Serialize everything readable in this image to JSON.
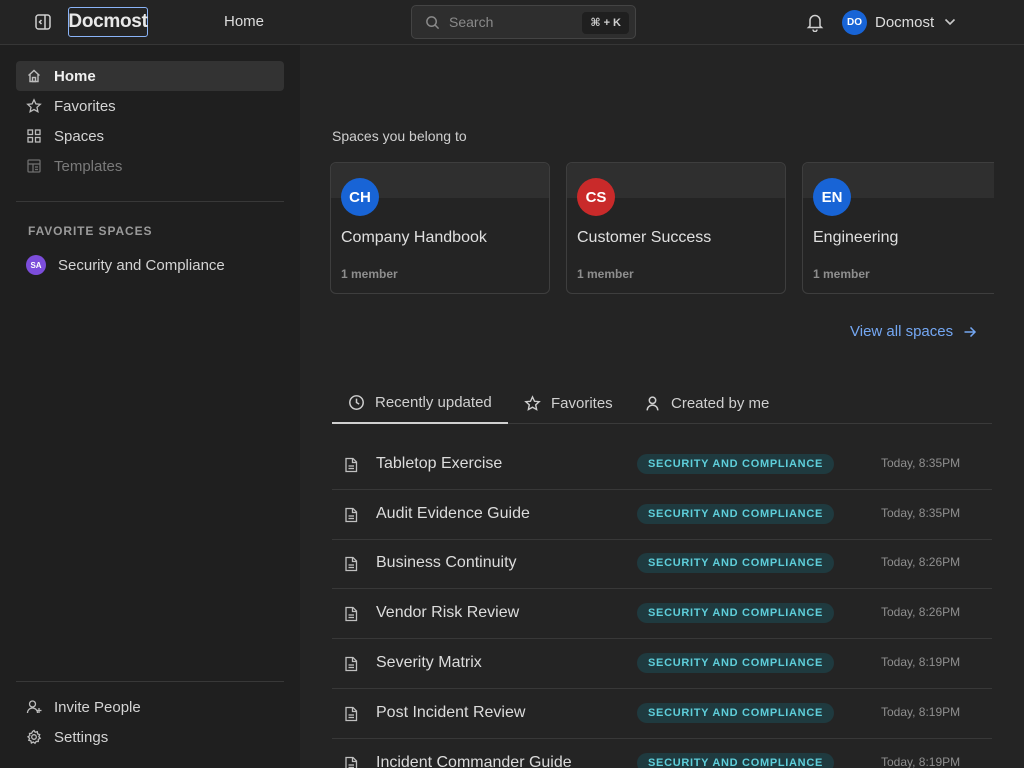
{
  "header": {
    "logo": "Docmost",
    "home": "Home",
    "search_placeholder": "Search",
    "search_shortcut": "⌘ + K",
    "user_initials": "DO",
    "user_name": "Docmost"
  },
  "sidebar": {
    "items": [
      {
        "label": "Home",
        "icon": "home-icon",
        "active": true
      },
      {
        "label": "Favorites",
        "icon": "star-icon"
      },
      {
        "label": "Spaces",
        "icon": "grid-icon"
      },
      {
        "label": "Templates",
        "icon": "template-icon",
        "disabled": true
      }
    ],
    "favorites_heading": "FAVORITE SPACES",
    "favorite_spaces": [
      {
        "initials": "SA",
        "label": "Security and Compliance",
        "color": "#7c4ddb"
      }
    ],
    "footer": [
      {
        "label": "Invite People",
        "icon": "user-plus-icon"
      },
      {
        "label": "Settings",
        "icon": "settings-icon"
      }
    ]
  },
  "main": {
    "spaces_title": "Spaces you belong to",
    "spaces": [
      {
        "initials": "CH",
        "name": "Company Handbook",
        "members": "1 member",
        "color": "#1864d6"
      },
      {
        "initials": "CS",
        "name": "Customer Success",
        "members": "1 member",
        "color": "#c92a2a"
      },
      {
        "initials": "EN",
        "name": "Engineering",
        "members": "1 member",
        "color": "#1864d6"
      }
    ],
    "view_all": "View all spaces",
    "tabs": [
      {
        "label": "Recently updated",
        "icon": "clock-icon",
        "active": true
      },
      {
        "label": "Favorites",
        "icon": "star-icon"
      },
      {
        "label": "Created by me",
        "icon": "user-icon"
      }
    ],
    "pages": [
      {
        "title": "Tabletop Exercise",
        "space": "SECURITY AND COMPLIANCE",
        "time": "Today, 8:35PM"
      },
      {
        "title": "Audit Evidence Guide",
        "space": "SECURITY AND COMPLIANCE",
        "time": "Today, 8:35PM"
      },
      {
        "title": "Business Continuity",
        "space": "SECURITY AND COMPLIANCE",
        "time": "Today, 8:26PM"
      },
      {
        "title": "Vendor Risk Review",
        "space": "SECURITY AND COMPLIANCE",
        "time": "Today, 8:26PM"
      },
      {
        "title": "Severity Matrix",
        "space": "SECURITY AND COMPLIANCE",
        "time": "Today, 8:19PM"
      },
      {
        "title": "Post Incident Review",
        "space": "SECURITY AND COMPLIANCE",
        "time": "Today, 8:19PM"
      },
      {
        "title": "Incident Commander Guide",
        "space": "SECURITY AND COMPLIANCE",
        "time": "Today, 8:19PM"
      }
    ]
  }
}
